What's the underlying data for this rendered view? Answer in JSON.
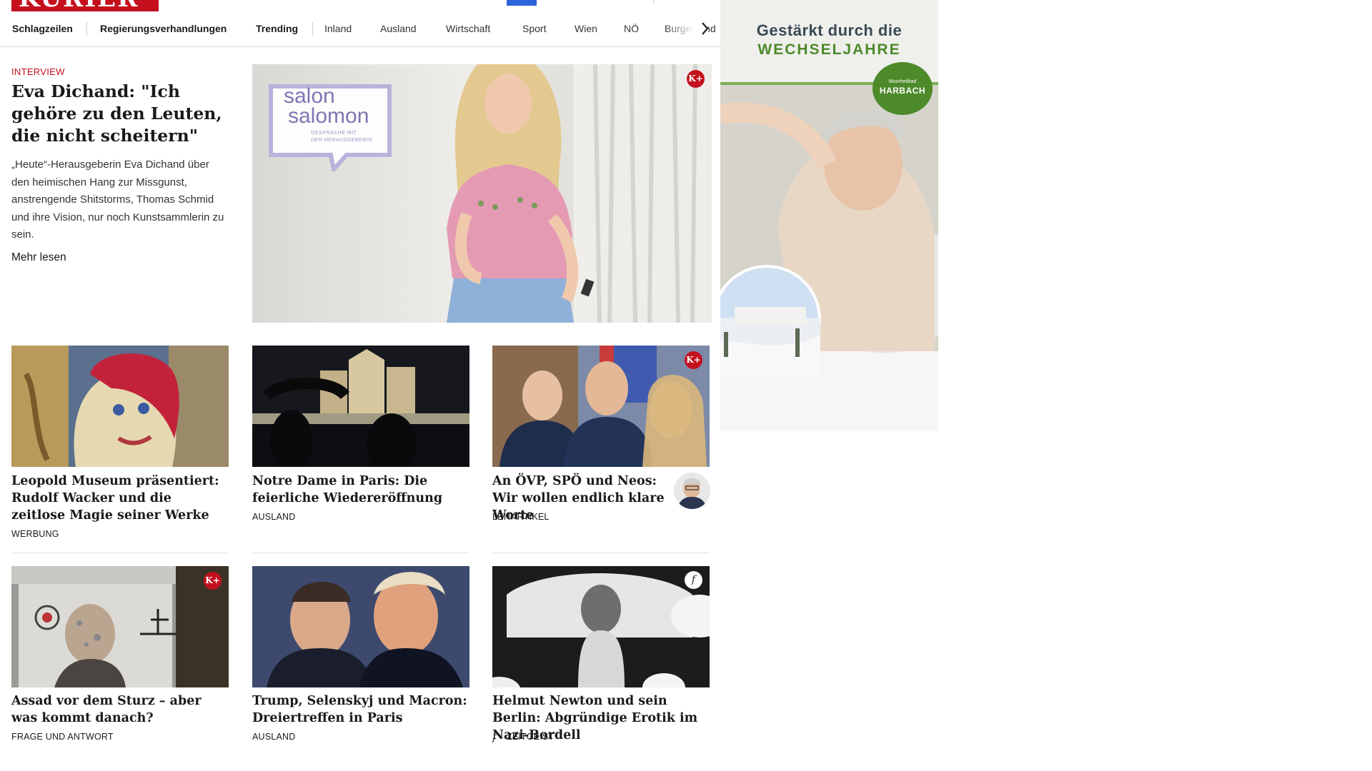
{
  "brand": {
    "logo_text": "KURIER"
  },
  "nav": {
    "items": [
      {
        "label": "Schlagzeilen",
        "bold": true
      },
      {
        "label": "Regierungsverhandlungen",
        "bold": true
      },
      {
        "label": "Trending",
        "bold": true
      },
      {
        "label": "Inland",
        "bold": false
      },
      {
        "label": "Ausland",
        "bold": false
      },
      {
        "label": "Wirtschaft",
        "bold": false
      },
      {
        "label": "Sport",
        "bold": false
      },
      {
        "label": "Wien",
        "bold": false
      },
      {
        "label": "NÖ",
        "bold": false
      },
      {
        "label": "Burgenland",
        "bold": false
      }
    ],
    "next_icon": "chevron-right-icon"
  },
  "hero": {
    "kicker": "INTERVIEW",
    "title": "Eva Dichand: \"Ich gehöre zu den Leuten, die nicht scheitern\"",
    "description": "„Heute“-Herausgeberin Eva Dichand über den heimischen Hang zur Missgunst, anstrengende Shitstorms, Thomas Schmid und ihre Vision, nur noch Kunstsammlerin zu sein.",
    "more_label": "Mehr lesen",
    "image_badge": "K+",
    "image_overlay": {
      "line1": "salon",
      "line2": "salomon",
      "sub1": "GESPRÄCHE MIT",
      "sub2": "DER HERAUSGEBERIN"
    }
  },
  "cards": [
    {
      "title": "Leopold Museum präsentiert: Ru­dolf Wacker und die zeitlose Magie seiner Werke",
      "category": "WERBUNG",
      "badge": null
    },
    {
      "title": "Notre Dame in Paris: Die feierliche Wiedereröffnung",
      "category": "AUSLAND",
      "badge": null
    },
    {
      "title": "An ÖVP, SPÖ und Neos: Wir wollen endlich klare Worte",
      "category": "LEITARTIKEL",
      "badge": "K+"
    },
    {
      "title": "Assad vor dem Sturz – aber was kommt danach?",
      "category": "FRAGE UND ANTWORT",
      "badge": "K+"
    },
    {
      "title": "Trump, Selenskyj und Macron: Dreiertreffen in Paris",
      "category": "AUSLAND",
      "badge": null
    },
    {
      "title": "Helmut Newton und sein Berlin: Abgründige Erotik im Nazi-Bordell",
      "category": "ZEITGEIST",
      "badge": "f"
    }
  ],
  "ad": {
    "line1": "Gestärkt durch die",
    "line2": "WECHSELJAHRE",
    "badge_small": "Moorheilbad",
    "badge_name": "HARBACH"
  },
  "colors": {
    "brand_red": "#c4101d",
    "ad_green": "#4d8a2a",
    "link_blue": "#2b65d9"
  }
}
